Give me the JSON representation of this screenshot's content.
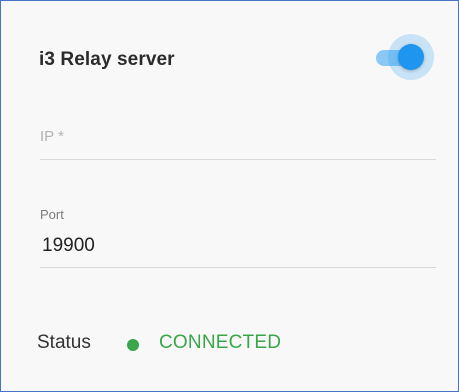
{
  "card": {
    "title": "i3 Relay server",
    "toggle": {
      "state": "on",
      "color": "#1e96ef"
    }
  },
  "fields": {
    "ip": {
      "placeholder": "IP *",
      "value": ""
    },
    "port": {
      "label": "Port",
      "value": "19900"
    }
  },
  "status": {
    "label": "Status",
    "value": "CONNECTED",
    "color": "#3aa54a"
  }
}
